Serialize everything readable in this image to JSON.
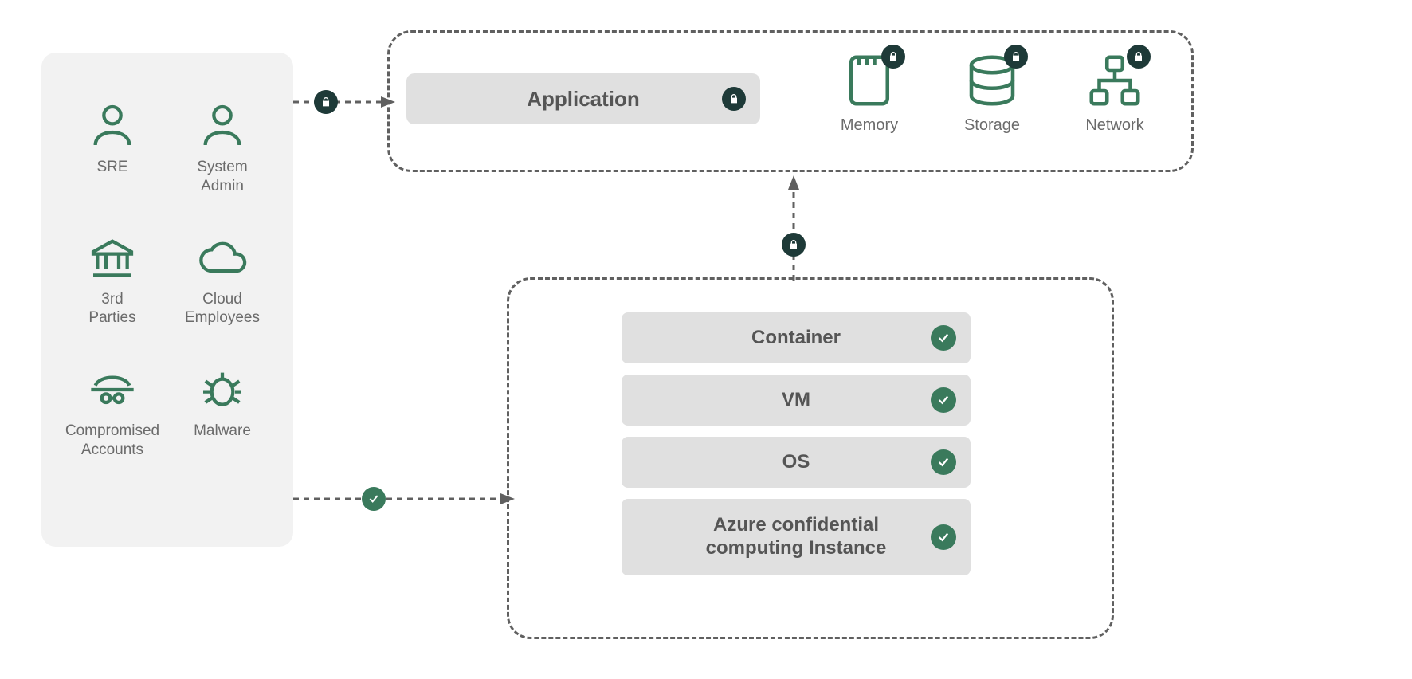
{
  "threats": {
    "sre": "SRE",
    "sysadmin": "System\nAdmin",
    "third_parties": "3rd\nParties",
    "cloud_employees": "Cloud\nEmployees",
    "compromised_accounts": "Compromised\nAccounts",
    "malware": "Malware"
  },
  "protected": {
    "application": "Application",
    "memory": "Memory",
    "storage": "Storage",
    "network": "Network"
  },
  "stack": {
    "container": "Container",
    "vm": "VM",
    "os": "OS",
    "instance": "Azure confidential computing Instance"
  }
}
